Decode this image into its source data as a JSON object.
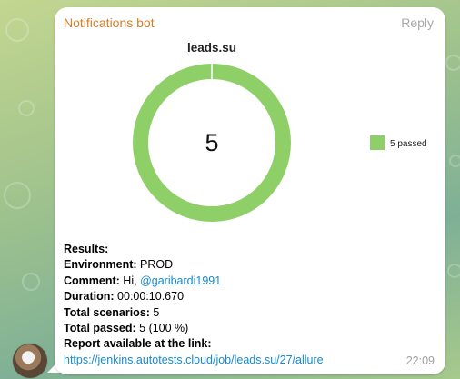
{
  "message": {
    "sender": "Notifications bot",
    "reply_label": "Reply",
    "time": "22:09"
  },
  "report_image": {
    "title": "leads.su",
    "center_value": "5",
    "colors": {
      "passed": "#8fcf68",
      "background": "#ffffff"
    }
  },
  "chart_data": {
    "type": "pie",
    "title": "leads.su",
    "slices": [
      {
        "label": "5 passed",
        "value": 5
      }
    ],
    "legend_placement": "right"
  },
  "report_text": {
    "results_label": "Results:",
    "environment_label": "Environment:",
    "environment_value": "PROD",
    "comment_label": "Comment:",
    "comment_prefix": "Hi,",
    "comment_mention": "@garibardi1991",
    "duration_label": "Duration:",
    "duration_value": "00:00:10.670",
    "scenarios_label": "Total scenarios:",
    "scenarios_value": "5",
    "passed_label": "Total passed:",
    "passed_value": "5 (100 %)",
    "report_label": "Report available at the link:",
    "report_url": "https://jenkins.autotests.cloud/job/leads.su/27/allure"
  }
}
